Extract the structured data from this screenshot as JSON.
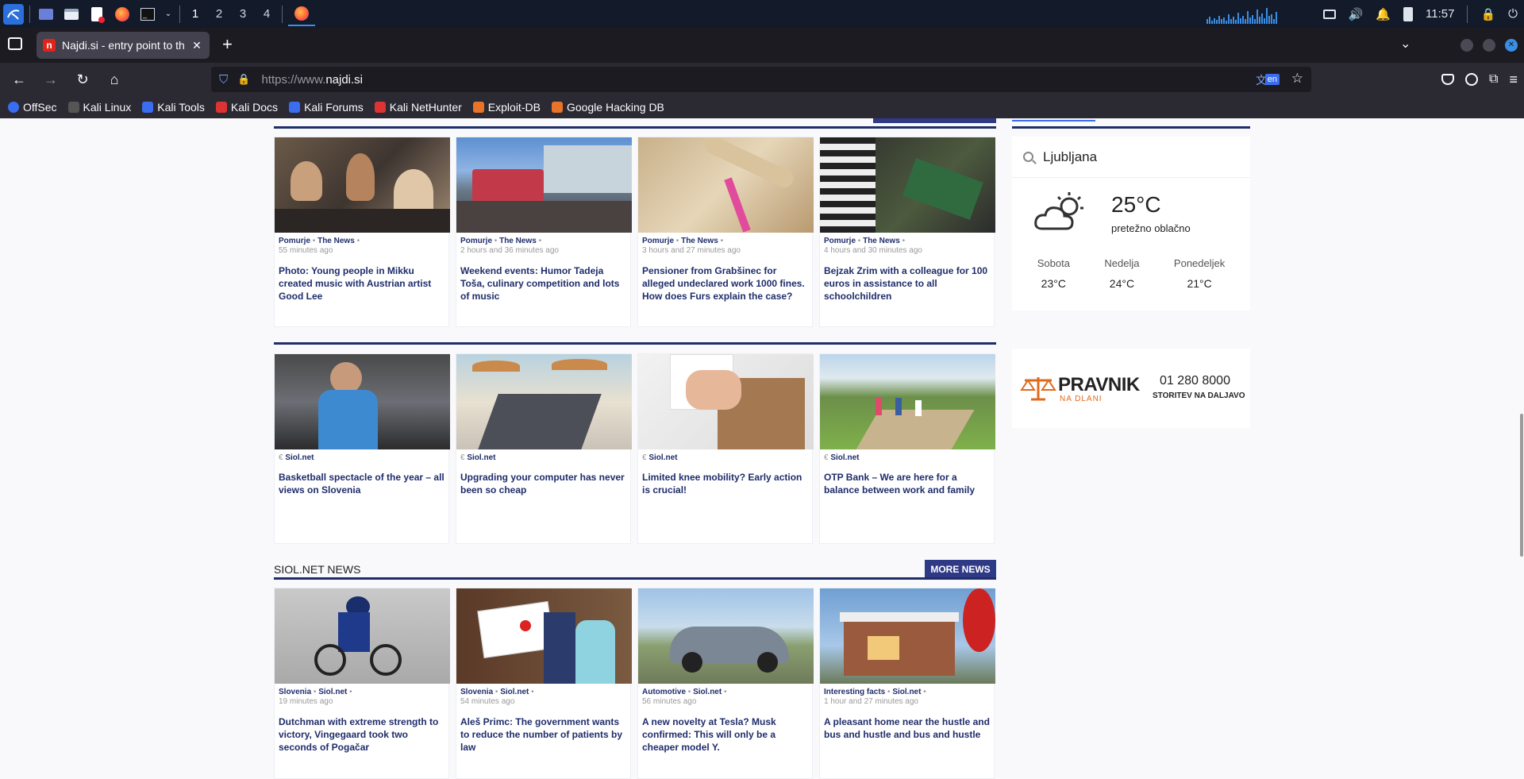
{
  "taskbar": {
    "workspaces": [
      "1",
      "2",
      "3",
      "4"
    ],
    "clock": "11:57"
  },
  "browser": {
    "tab_title": "Najdi.si - entry point to th",
    "tab_favicon": "n",
    "url_scheme": "https://www.",
    "url_host": "najdi.si",
    "translate_badge": "en"
  },
  "bookmarks": [
    {
      "label": "OffSec",
      "color": "#3a6df0"
    },
    {
      "label": "Kali Linux",
      "color": "#3d3d3d"
    },
    {
      "label": "Kali Tools",
      "color": "#3a6df0"
    },
    {
      "label": "Kali Docs",
      "color": "#d33"
    },
    {
      "label": "Kali Forums",
      "color": "#3a6df0"
    },
    {
      "label": "Kali NetHunter",
      "color": "#d33"
    },
    {
      "label": "Exploit-DB",
      "color": "#e8742a"
    },
    {
      "label": "Google Hacking DB",
      "color": "#e8742a"
    }
  ],
  "row1": [
    {
      "category": "Pomurje",
      "source": "The News",
      "time": "55 minutes ago",
      "headline": "Photo: Young people in Mikku created music with Austrian artist Good Lee",
      "img": "people"
    },
    {
      "category": "Pomurje",
      "source": "The News",
      "time": "2 hours and 36 minutes ago",
      "headline": "Weekend events: Humor Tadeja Toša, culinary competition and lots of music",
      "img": "event"
    },
    {
      "category": "Pomurje",
      "source": "The News",
      "time": "3 hours and 27 minutes ago",
      "headline": "Pensioner from Grabšinec for alleged undeclared work 1000 fines. How does Furs explain the case?",
      "img": "roller"
    },
    {
      "category": "Pomurje",
      "source": "The News",
      "time": "4 hours and 30 minutes ago",
      "headline": "Bejzak Zrim with a colleague for 100 euros in assistance to all schoolchildren",
      "img": "folder"
    }
  ],
  "row2": [
    {
      "sponsor": "Siol.net",
      "headline": "Basketball spectacle of the year – all views on Slovenia",
      "img": "basket"
    },
    {
      "sponsor": "Siol.net",
      "headline": "Upgrading your computer has never been so cheap",
      "img": "laptop"
    },
    {
      "sponsor": "Siol.net",
      "headline": "Limited knee mobility? Early action is crucial!",
      "img": "knee"
    },
    {
      "sponsor": "Siol.net",
      "headline": "OTP Bank – We are here for a balance between work and family",
      "img": "hike"
    }
  ],
  "siol_section": {
    "label": "SIOL.NET NEWS",
    "more_label": "MORE NEWS"
  },
  "row3": [
    {
      "category": "Slovenia",
      "source": "Siol.net",
      "time": "19 minutes ago",
      "headline": "Dutchman with extreme strength to victory, Vingegaard took two seconds of Pogačar",
      "img": "cyclist"
    },
    {
      "category": "Slovenia",
      "source": "Siol.net",
      "time": "54 minutes ago",
      "headline": "Aleš Primc: The government wants to reduce the number of patients by law",
      "img": "sign"
    },
    {
      "category": "Automotive",
      "source": "Siol.net",
      "time": "56 minutes ago",
      "headline": "A new novelty at Tesla? Musk confirmed: This will only be a cheaper model Y.",
      "img": "car"
    },
    {
      "category": "Interesting facts",
      "source": "Siol.net",
      "time": "1 hour and 27 minutes ago",
      "headline": "A pleasant home near the hustle and bus and hustle and bus and hustle",
      "img": "house"
    }
  ],
  "weather": {
    "location": "Ljubljana",
    "temp": "25°C",
    "condition": "pretežno oblačno",
    "forecast": [
      {
        "day": "Sobota",
        "temp": "23°C"
      },
      {
        "day": "Nedelja",
        "temp": "24°C"
      },
      {
        "day": "Ponedeljek",
        "temp": "21°C"
      }
    ]
  },
  "ad": {
    "brand": "PRAVNIK",
    "brand_sub": "NA DLANI",
    "phone": "01 280 8000",
    "tagline": "STORITEV NA DALJAVO"
  },
  "colors": {
    "accent": "#2f3a87",
    "headline": "#1f2d6b",
    "ad_orange": "#e06a1b"
  }
}
